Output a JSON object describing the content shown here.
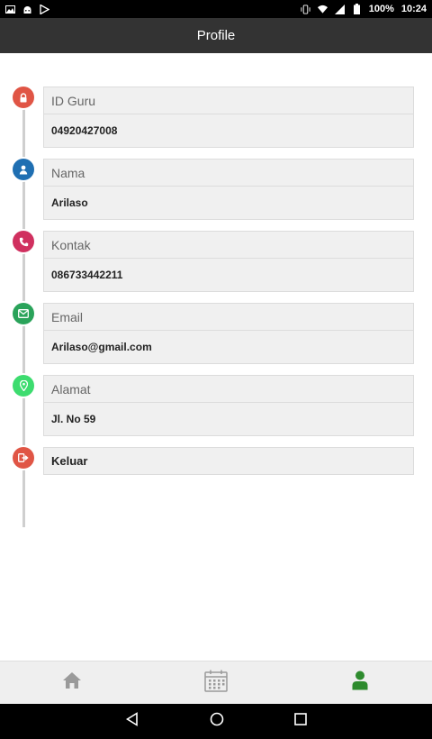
{
  "status_bar": {
    "battery": "100%",
    "time": "10:24"
  },
  "app_bar": {
    "title": "Profile"
  },
  "profile": {
    "id_label": "ID Guru",
    "id_value": "04920427008",
    "name_label": "Nama",
    "name_value": "Arilaso",
    "contact_label": "Kontak",
    "contact_value": "086733442211",
    "email_label": "Email",
    "email_value": "Arilaso@gmail.com",
    "address_label": "Alamat",
    "address_value": "Jl. No 59",
    "logout_label": "Keluar"
  },
  "colors": {
    "id": "#e05545",
    "name": "#1f6fb2",
    "contact": "#d0305f",
    "email": "#2aa35a",
    "address": "#3ddc6f",
    "logout": "#e05545",
    "nav_active": "#2e8b2e",
    "nav_inactive": "#9a9a9a"
  },
  "icons": {
    "id": "lock-icon",
    "name": "user-icon",
    "contact": "phone-icon",
    "email": "envelope-icon",
    "address": "map-marker-icon",
    "logout": "sign-out-icon",
    "nav_home": "home-icon",
    "nav_calendar": "calendar-icon",
    "nav_profile": "user-icon"
  }
}
